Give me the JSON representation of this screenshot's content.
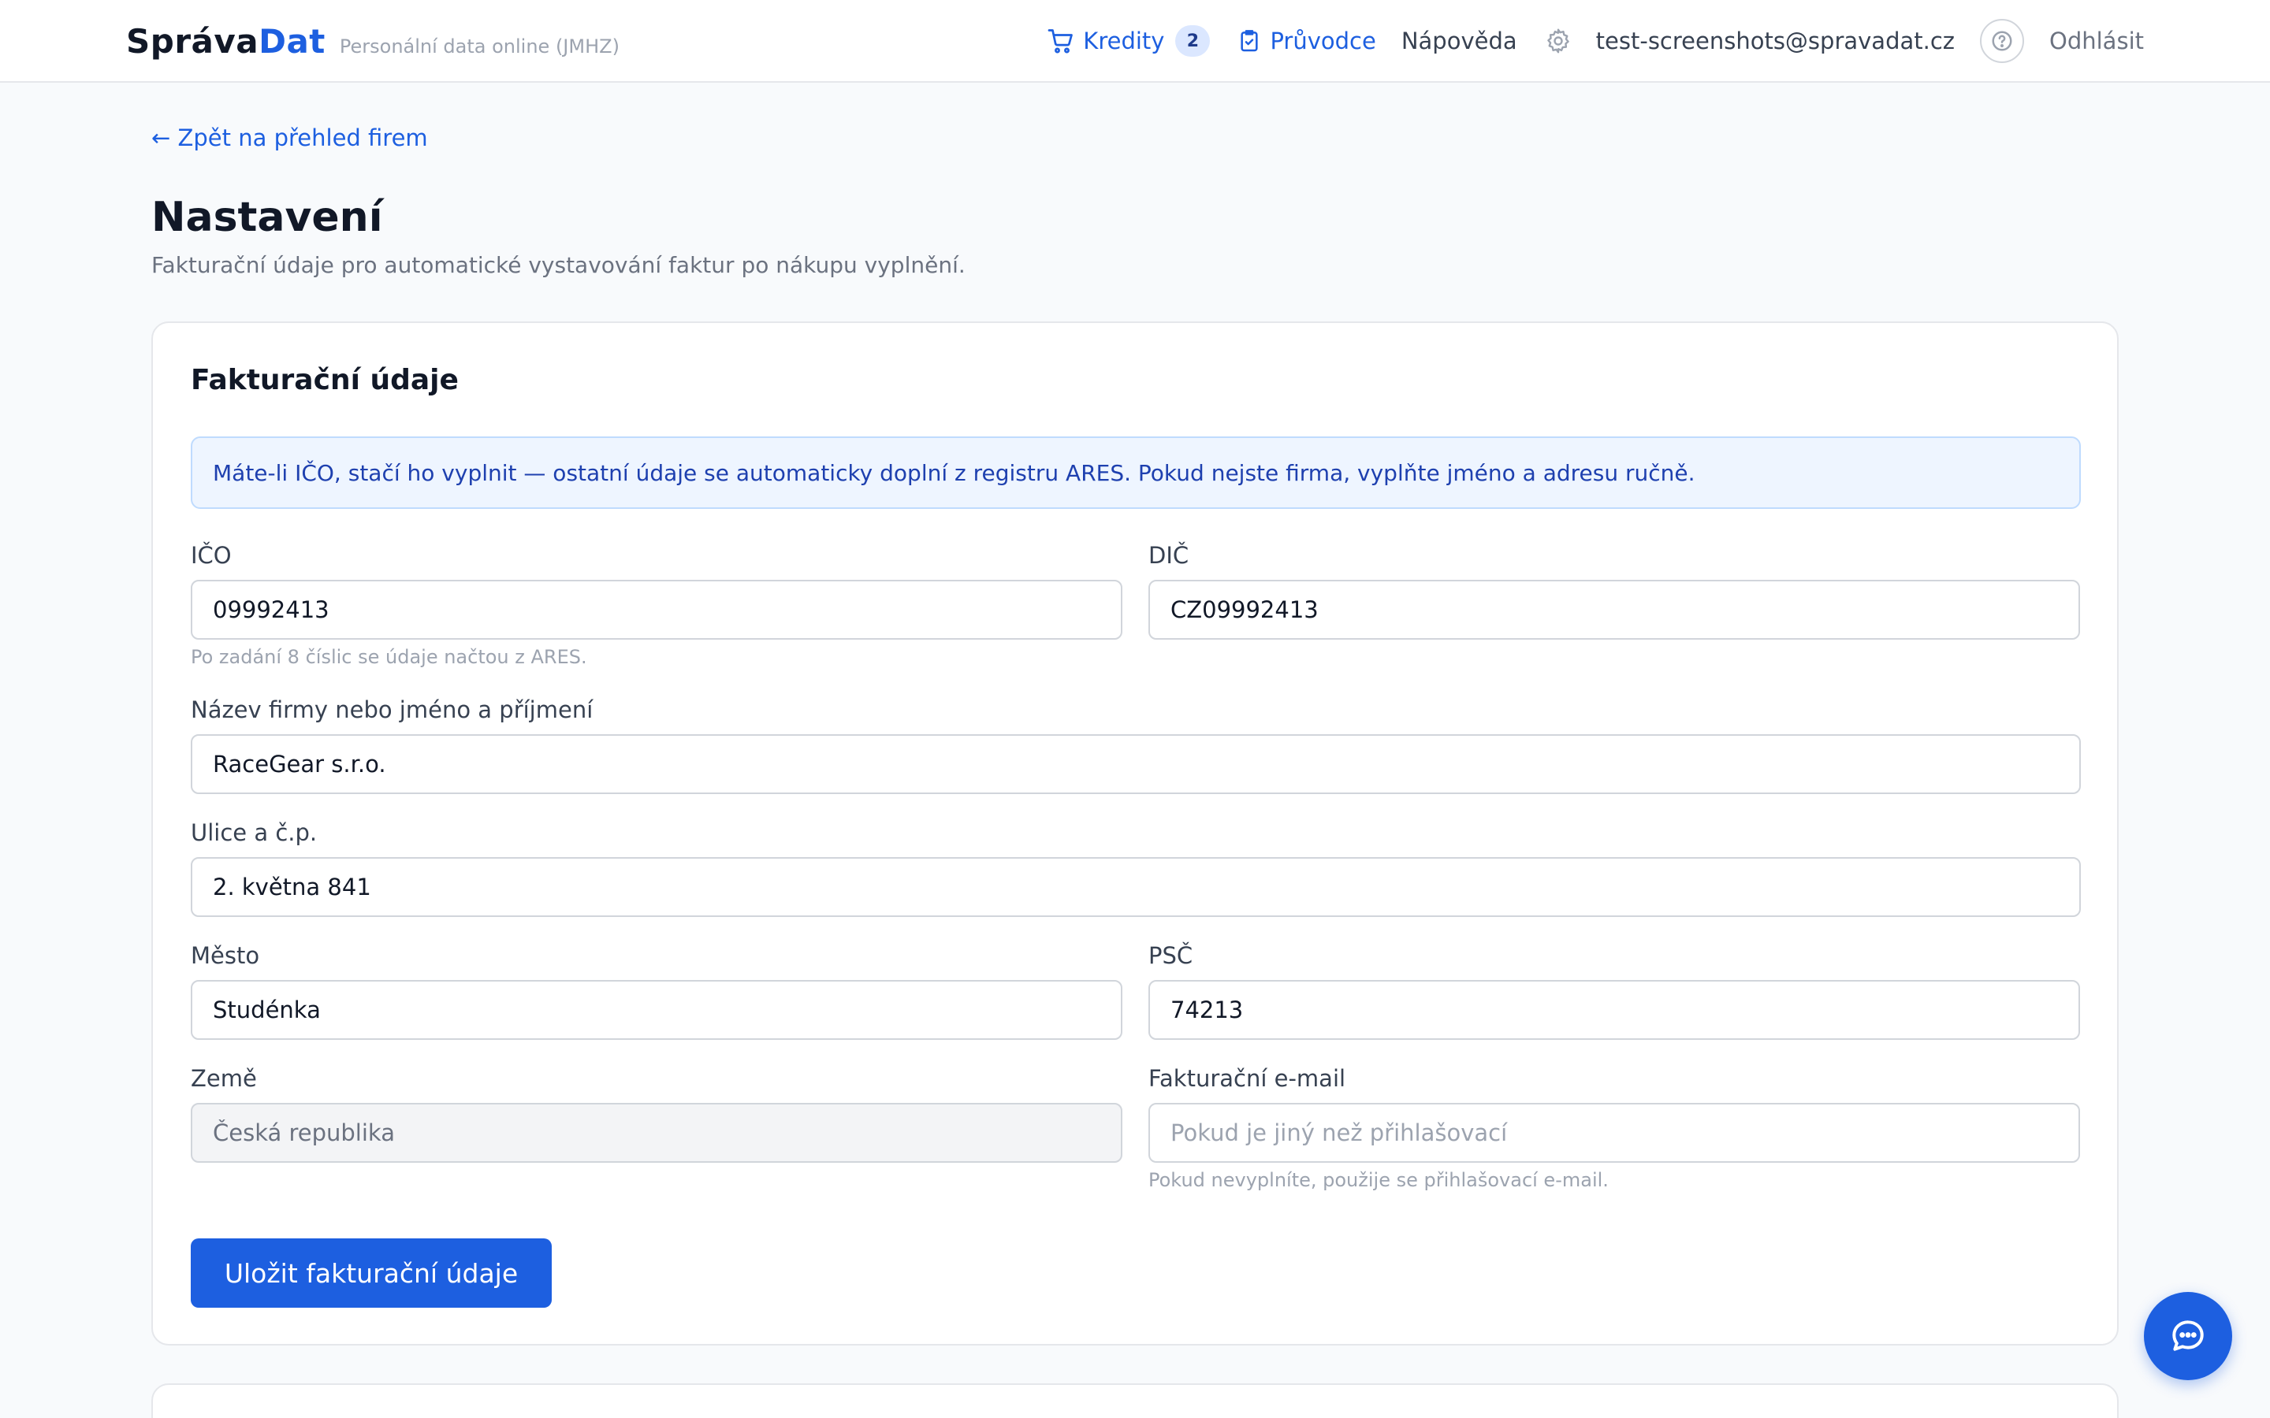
{
  "header": {
    "brand_part1": "Správa",
    "brand_part2": "Dat",
    "tagline": "Personální data online (JMHZ)",
    "credits_label": "Kredity",
    "credits_count": "2",
    "guide_label": "Průvodce",
    "help_label": "Nápověda",
    "user_email": "test-screenshots@spravadat.cz",
    "logout_label": "Odhlásit",
    "icons": [
      "cart-icon",
      "clipboard-check-icon",
      "gear-icon",
      "help-circle-icon"
    ]
  },
  "page": {
    "back_link": "← Zpět na přehled firem",
    "title": "Nastavení",
    "subtitle": "Fakturační údaje pro automatické vystavování faktur po nákupu vyplnění."
  },
  "billing": {
    "section_title": "Fakturační údaje",
    "info_text": "Máte-li IČO, stačí ho vyplnit — ostatní údaje se automaticky doplní z registru ARES. Pokud nejste firma, vyplňte jméno a adresu ručně.",
    "ico": {
      "label": "IČO",
      "value": "09992413",
      "hint": "Po zadání 8 číslic se údaje načtou z ARES."
    },
    "dic": {
      "label": "DIČ",
      "value": "CZ09992413"
    },
    "name": {
      "label": "Název firmy nebo jméno a příjmení",
      "value": "RaceGear s.r.o."
    },
    "street": {
      "label": "Ulice a č.p.",
      "value": "2. května 841"
    },
    "city": {
      "label": "Město",
      "value": "Studénka"
    },
    "zip": {
      "label": "PSČ",
      "value": "74213"
    },
    "country": {
      "label": "Země",
      "value": "Česká republika"
    },
    "email": {
      "label": "Fakturační e-mail",
      "value": "",
      "placeholder": "Pokud je jiný než přihlašovací",
      "hint": "Pokud nevyplníte, použije se přihlašovací e-mail."
    },
    "save_label": "Uložit fakturační údaje"
  },
  "colors": {
    "accent": "#1d5fe0",
    "background": "#f8fafc",
    "info_bg": "#eef5ff",
    "info_text": "#1e40af"
  },
  "chat_button_icon": "chat-bubble-icon"
}
